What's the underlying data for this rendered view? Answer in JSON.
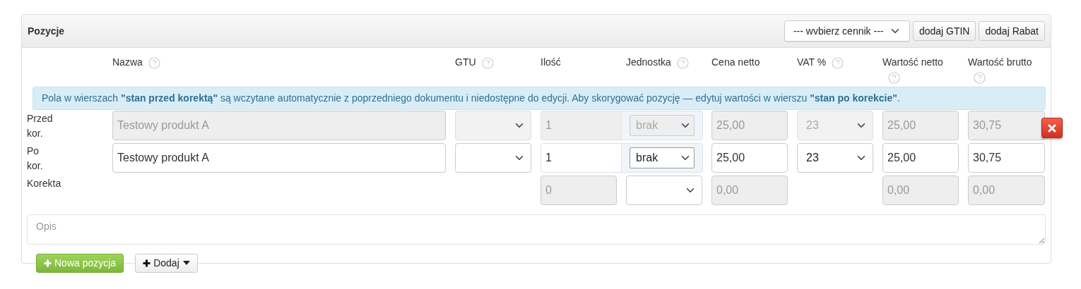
{
  "panel": {
    "title": "Pozycje",
    "pricelist_select": "--- wvbierz cennik ---",
    "buttons": [
      "dodaj GTIN",
      "dodaj Rabat"
    ]
  },
  "columns": [
    {
      "label": "Nazwa",
      "help": true
    },
    {
      "label": "GTU",
      "help": true
    },
    {
      "label": "Ilość",
      "help": false
    },
    {
      "label": "Jednostka",
      "help": true
    },
    {
      "label": "Cena netto",
      "help": false
    },
    {
      "label": "VAT %",
      "help": true
    },
    {
      "label": "Wartość netto",
      "help": true
    },
    {
      "label": "Wartość brutto",
      "help": true
    }
  ],
  "notice": "Pola w wierszach **\"stan przed korektą\"** są wczytane automatycznie z poprzedniego dokumentu i niedostępne do edycji. Aby skorygować pozycję — edytuj wartości w wierszu **\"stan po korekcie\"**.",
  "rows": [
    {
      "kind": "before",
      "label": "Przed kor.",
      "disabled": true,
      "removable": true,
      "name": "Testowy produkt A",
      "qty": "1",
      "unit": "brak",
      "net_price": "25,00",
      "vat": "23",
      "net_value": "25,00",
      "gross_value": "30,75"
    },
    {
      "kind": "after",
      "label": "Po kor.",
      "disabled": false,
      "removable": false,
      "name": "Testowy produkt A",
      "qty": "1",
      "unit": "brak",
      "net_price": "25,00",
      "vat": "23",
      "net_value": "25,00",
      "gross_value": "30,75"
    },
    {
      "kind": "correction",
      "label": "Korekta",
      "disabled": true,
      "removable": false,
      "qty": "0",
      "net_price": "0,00",
      "net_value": "0,00",
      "gross_value": "0,00"
    }
  ],
  "description": {
    "placeholder": "Opis"
  },
  "actions": [
    {
      "kind": "primary",
      "label": "Nowa pozycja"
    },
    {
      "kind": "dropdown",
      "label": "Dodaj"
    }
  ]
}
